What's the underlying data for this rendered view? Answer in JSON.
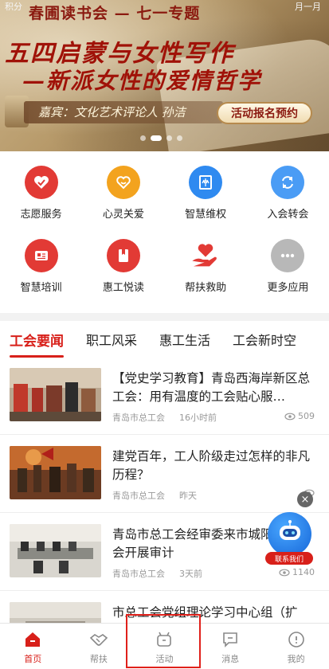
{
  "banner": {
    "score_label": "积分",
    "month_label": "月一月",
    "series_title": "春圃读书会 — 七一专题",
    "headline1": "五四启蒙与女性写作",
    "headline2": "—新派女性的爱情哲学",
    "guest": "嘉宾：文化艺术评论人 孙洁",
    "register_button": "活动报名预约",
    "slides_total": 4,
    "slide_active": 1
  },
  "services": [
    {
      "label": "志愿服务",
      "icon": "heart-hands-icon",
      "color": "#e23a35"
    },
    {
      "label": "心灵关爱",
      "icon": "heart-love-icon",
      "color": "#f3a31e"
    },
    {
      "label": "智慧维权",
      "icon": "law-book-icon",
      "color": "#2f8af0"
    },
    {
      "label": "入会转会",
      "icon": "transfer-icon",
      "color": "#4a9cf5"
    },
    {
      "label": "智慧培训",
      "icon": "training-icon",
      "color": "#e23a35"
    },
    {
      "label": "惠工悦读",
      "icon": "book-icon",
      "color": "#e23a35"
    },
    {
      "label": "帮扶救助",
      "icon": "helping-hand-icon",
      "color": "#e23a35"
    },
    {
      "label": "更多应用",
      "icon": "more-icon",
      "color": "#b8b8b8"
    }
  ],
  "tabs": [
    "工会要闻",
    "职工风采",
    "惠工生活",
    "工会新时空"
  ],
  "news": [
    {
      "title": "【党史学习教育】青岛西海岸新区总工会：用有温度的工会贴心服…",
      "source": "青岛市总工会",
      "time": "16小时前",
      "views": "509"
    },
    {
      "title": "建党百年，工人阶级走过怎样的非凡历程？",
      "source": "青岛市总工会",
      "time": "昨天",
      "views": ""
    },
    {
      "title": "青岛市总工会经审委来市城阳区总工会开展审计",
      "source": "青岛市总工会",
      "time": "3天前",
      "views": "1140"
    },
    {
      "title": "市总工会党组理论学习中心组（扩",
      "source": "",
      "time": "",
      "views": ""
    }
  ],
  "assistant": {
    "label": "联系我们",
    "close": "×"
  },
  "bottom_nav": [
    {
      "label": "首页",
      "icon": "home-icon",
      "active": true
    },
    {
      "label": "帮扶",
      "icon": "handshake-icon",
      "active": false
    },
    {
      "label": "活动",
      "icon": "activity-icon",
      "active": false
    },
    {
      "label": "消息",
      "icon": "message-icon",
      "active": false
    },
    {
      "label": "我的",
      "icon": "profile-icon",
      "active": false
    }
  ],
  "colors": {
    "accent": "#d8201a",
    "highlight_box": "#e0201a"
  }
}
